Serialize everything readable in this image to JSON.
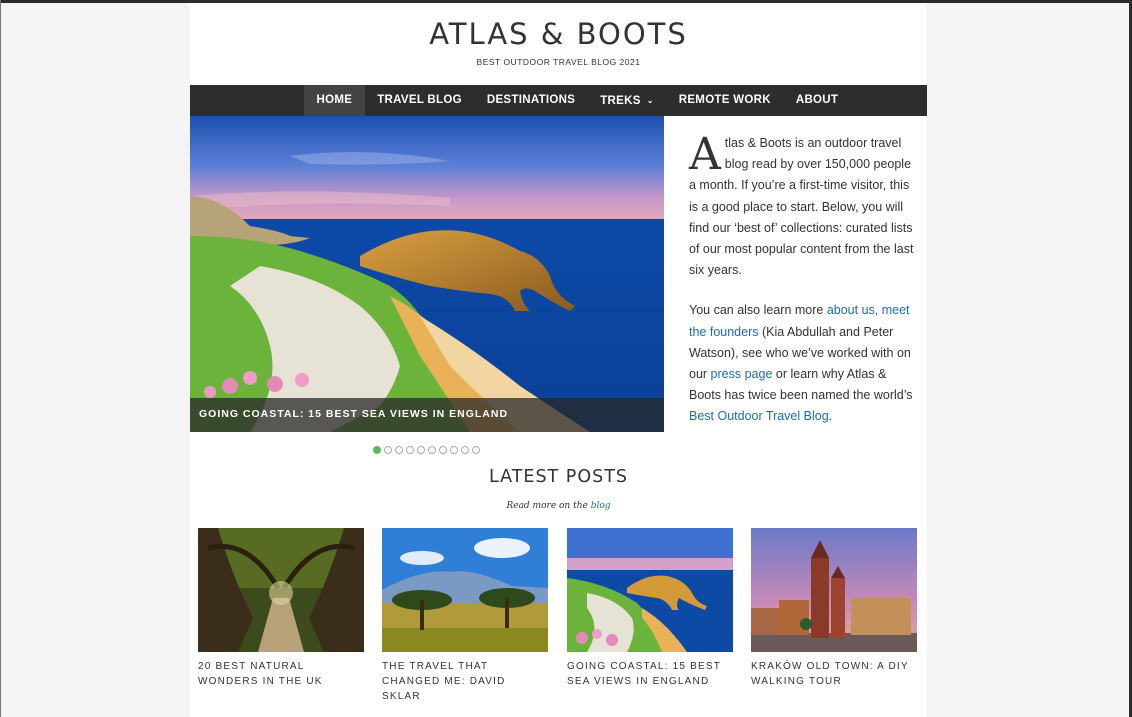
{
  "site": {
    "title": "ATLAS & BOOTS",
    "tagline": "BEST OUTDOOR TRAVEL BLOG 2021"
  },
  "nav": {
    "items": [
      {
        "label": "HOME",
        "active": true
      },
      {
        "label": "TRAVEL BLOG"
      },
      {
        "label": "DESTINATIONS"
      },
      {
        "label": "TREKS",
        "has_dropdown": true
      },
      {
        "label": "REMOTE WORK"
      },
      {
        "label": "ABOUT"
      }
    ]
  },
  "hero": {
    "caption": "GOING COASTAL: 15 BEST SEA VIEWS IN ENGLAND",
    "slide_count": 10,
    "active_slide": 1
  },
  "intro": {
    "dropcap": "A",
    "p1": "tlas & Boots is an outdoor travel blog read by over 150,000 people a month. If you’re a first-time visitor, this is a good place to start. Below, you will find our ‘best of’ collections: curated lists of our most popular content from the last six years.",
    "p2_a": "You can also learn more ",
    "p2_link1": "about us, meet the founders",
    "p2_b": " (Kia Abdullah and Peter Watson), see who we’ve worked with on our ",
    "p2_link2": "press page",
    "p2_c": " or learn why Atlas & Boots has twice been named the world’s ",
    "p2_link3": "Best Outdoor Travel Blog",
    "p2_d": "."
  },
  "latest": {
    "heading": "LATEST POSTS",
    "read_more_prefix": "Read more on the ",
    "read_more_link": "blog",
    "posts": [
      {
        "title": "20 BEST NATURAL WONDERS IN THE UK"
      },
      {
        "title": "THE TRAVEL THAT CHANGED ME: DAVID SKLAR"
      },
      {
        "title": "GOING COASTAL: 15 BEST SEA VIEWS IN ENGLAND"
      },
      {
        "title": "KRAKÓW OLD TOWN: A DIY WALKING TOUR"
      }
    ]
  },
  "colors": {
    "nav_bg": "#2d2d2d",
    "link": "#1e6bb8",
    "active_dot": "#5cb85c"
  }
}
